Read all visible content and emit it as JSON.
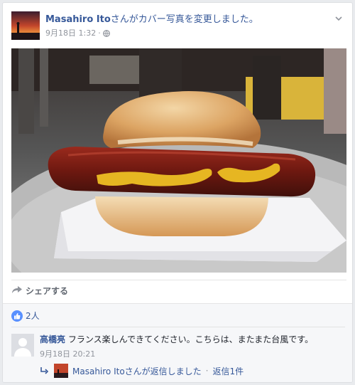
{
  "post": {
    "author": "Masahiro Ito",
    "action": "さんがカバー写真を変更しました。",
    "date": "9月18日 1:32",
    "separator": "·"
  },
  "share": {
    "label": "シェアする"
  },
  "likes": {
    "count": "2人"
  },
  "comment": {
    "author": "高橋亮",
    "text": "フランス楽しんできてください。こちらは、またまた台風です。",
    "timestamp": "9月18日 20:21"
  },
  "reply": {
    "text": "Masahiro Itoさんが返信しました",
    "separator": " · ",
    "count": "返信1件"
  },
  "colors": {
    "link": "#365899",
    "meta": "#90949c",
    "like": "#5890ff"
  }
}
